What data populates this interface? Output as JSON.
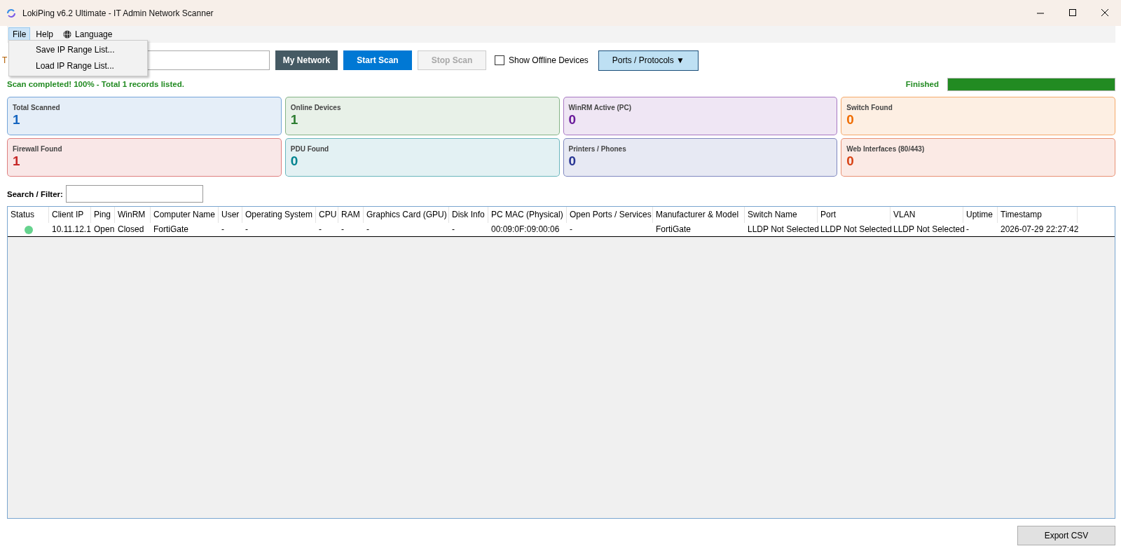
{
  "window": {
    "title": "LokiPing v6.2 Ultimate - IT Admin Network Scanner"
  },
  "menu": [
    {
      "label": "File",
      "selected": true,
      "kind": "text"
    },
    {
      "label": "Help",
      "selected": false,
      "kind": "text"
    },
    {
      "label": "Language",
      "selected": false,
      "kind": "globe"
    }
  ],
  "file_menu": [
    "Save IP Range List...",
    "Load IP Range List..."
  ],
  "toolbar": {
    "range_label": "T",
    "my_network": "My Network",
    "start_scan": "Start Scan",
    "stop_scan": "Stop Scan",
    "stop_disabled": true,
    "show_offline": {
      "label": "Show Offline Devices",
      "checked": false
    },
    "ports": "Ports / Protocols ▼"
  },
  "status": {
    "message": "Scan completed! 100% - Total 1 records listed.",
    "progress_label": "Finished",
    "level": 1
  },
  "cards": [
    {
      "label": "Total Scanned",
      "value": "1",
      "color": "#1565c0"
    },
    {
      "label": "Online Devices",
      "value": "1",
      "color": "#2e7d32"
    },
    {
      "label": "WinRM Active (PC)",
      "value": "0",
      "color": "#6a1b9a"
    },
    {
      "label": "Switch Found",
      "value": "0",
      "color": "#ef6c00"
    },
    {
      "label": "Firewall Found",
      "value": "1",
      "color": "#c62828"
    },
    {
      "label": "PDU Found",
      "value": "0",
      "color": "#00838f"
    },
    {
      "label": "Printers / Phones",
      "value": "0",
      "color": "#283593"
    },
    {
      "label": "Web Interfaces (80/443)",
      "value": "0",
      "color": "#d84315"
    }
  ],
  "search": {
    "label": "Search / Filter:"
  },
  "table": {
    "columns": [
      "Status",
      "Client IP",
      "Ping",
      "WinRM",
      "Computer Name",
      "User",
      "Operating System",
      "CPU",
      "RAM",
      "Graphics Card (GPU)",
      "Disk Info",
      "PC MAC (Physical)",
      "Open Ports / Services",
      "Manufacturer & Model",
      "Switch Name",
      "Port",
      "VLAN",
      "Uptime",
      "Timestamp"
    ],
    "rows": [
      {
        "cells": [
          {
            "color": "#66d38e"
          },
          "10.11.12.1",
          "Open",
          "Closed",
          "FortiGate",
          "-",
          "-",
          "-",
          "-",
          "-",
          "-",
          "00:09:0F:09:00:06",
          "-",
          "FortiGate",
          "LLDP Not Selected",
          "LLDP Not Selected",
          "LLDP Not Selected",
          "-",
          "2026-07-29 22:27:42"
        ]
      }
    ]
  },
  "export_button": "Export CSV"
}
